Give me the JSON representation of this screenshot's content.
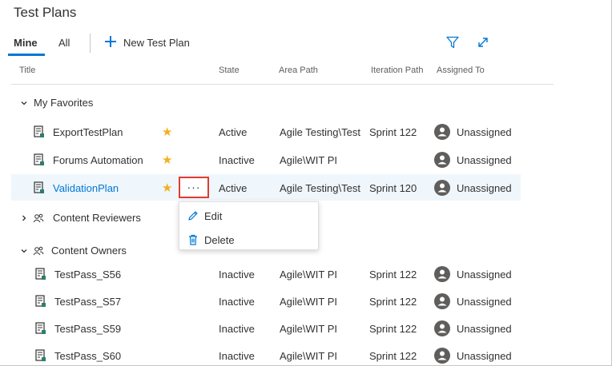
{
  "page": {
    "title": "Test Plans"
  },
  "tabs": [
    {
      "label": "Mine",
      "active": true
    },
    {
      "label": "All",
      "active": false
    }
  ],
  "toolbar": {
    "new_plan_label": "New Test Plan",
    "filter_icon": "filter-icon",
    "expand_icon": "expand-icon"
  },
  "columns": [
    "Title",
    "State",
    "Area Path",
    "Iteration Path",
    "Assigned To"
  ],
  "groups": {
    "favorites": {
      "label": "My Favorites",
      "rows": [
        {
          "title": "ExportTestPlan",
          "state": "Active",
          "area": "Agile Testing\\Test",
          "iteration": "Sprint 122",
          "assigned": "Unassigned"
        },
        {
          "title": "Forums Automation",
          "state": "Inactive",
          "area": "Agile\\WIT PI",
          "iteration": "",
          "assigned": "Unassigned"
        },
        {
          "title": "ValidationPlan",
          "state": "Active",
          "area": "Agile Testing\\Test",
          "iteration": "Sprint 120",
          "assigned": "Unassigned"
        }
      ]
    },
    "reviewers": {
      "label": "Content Reviewers"
    },
    "owners": {
      "label": "Content Owners",
      "rows": [
        {
          "title": "TestPass_S56",
          "state": "Inactive",
          "area": "Agile\\WIT PI",
          "iteration": "Sprint 122",
          "assigned": "Unassigned"
        },
        {
          "title": "TestPass_S57",
          "state": "Inactive",
          "area": "Agile\\WIT PI",
          "iteration": "Sprint 122",
          "assigned": "Unassigned"
        },
        {
          "title": "TestPass_S59",
          "state": "Inactive",
          "area": "Agile\\WIT PI",
          "iteration": "Sprint 122",
          "assigned": "Unassigned"
        },
        {
          "title": "TestPass_S60",
          "state": "Inactive",
          "area": "Agile\\WIT PI",
          "iteration": "Sprint 122",
          "assigned": "Unassigned"
        }
      ]
    }
  },
  "more_button": {
    "label": "···"
  },
  "context_menu": {
    "items": [
      {
        "label": "Edit",
        "icon": "pencil-icon"
      },
      {
        "label": "Delete",
        "icon": "trash-icon"
      }
    ]
  },
  "colors": {
    "accent": "#0078d4",
    "star": "#f2b01e",
    "highlight": "#e03c31",
    "selection": "#eff6fc"
  }
}
